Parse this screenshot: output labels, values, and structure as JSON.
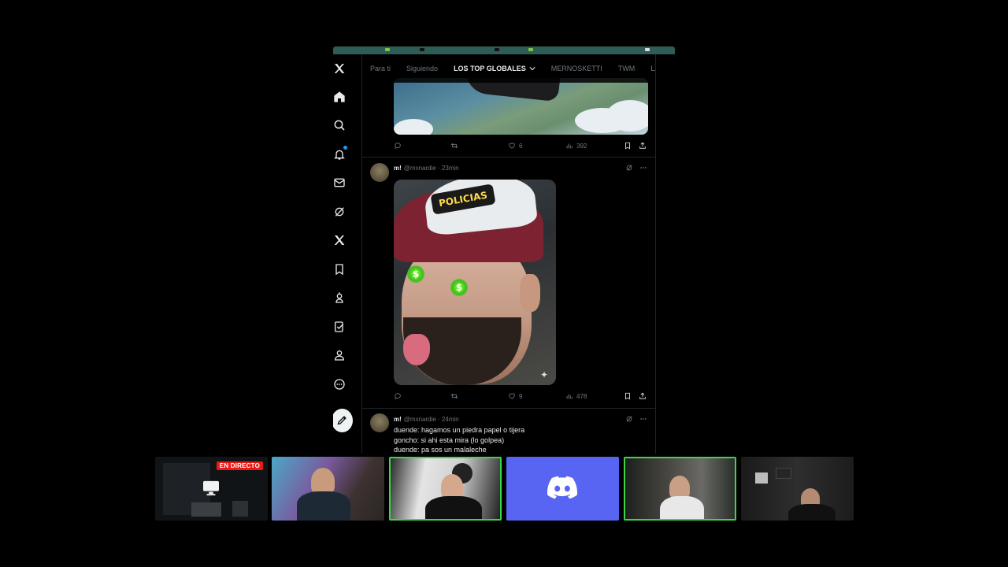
{
  "colors": {
    "accent": "#1d9bf0",
    "live": "#e91916",
    "discord": "#5865f2",
    "selected_border": "#3bd64a"
  },
  "sidebar": {
    "icons": [
      "x-logo-icon",
      "home-icon",
      "search-icon",
      "notifications-icon",
      "messages-icon",
      "grok-icon",
      "premium-x-icon",
      "bookmarks-icon",
      "communities-icon",
      "verified-orgs-icon",
      "profile-icon",
      "more-icon"
    ],
    "post_button_icon": "compose-icon"
  },
  "tabs": [
    {
      "label": "Para ti",
      "active": false
    },
    {
      "label": "Siguiendo",
      "active": false
    },
    {
      "label": "LOS TOP GLOBALES",
      "active": true,
      "has_dropdown": true
    },
    {
      "label": "MERNOSKETTI",
      "active": false
    },
    {
      "label": "TWM",
      "active": false
    },
    {
      "label": "LA",
      "active": false
    }
  ],
  "tweets": [
    {
      "actions": {
        "replies": "",
        "reposts": "",
        "likes": "6",
        "views": "392"
      }
    },
    {
      "name": "m!",
      "handle": "@mxnardie",
      "time": "23min",
      "media_text": {
        "cap_patch": "POLICIAS",
        "eye_symbol": "$"
      },
      "actions": {
        "replies": "",
        "reposts": "",
        "likes": "9",
        "views": "478"
      }
    },
    {
      "name": "m!",
      "handle": "@mxnardie",
      "time": "24min",
      "lines": [
        "duende: hagamos un piedra papel o tijera",
        "goncho: si ahi esta mira (lo golpea)",
        "duende: pa sos un malaleche"
      ]
    }
  ],
  "stream_bar": {
    "live_label": "EN DIRECTO",
    "tiles": [
      "screen-share",
      "webcam",
      "webcam",
      "discord",
      "webcam",
      "webcam"
    ],
    "selected": [
      2,
      4
    ]
  }
}
